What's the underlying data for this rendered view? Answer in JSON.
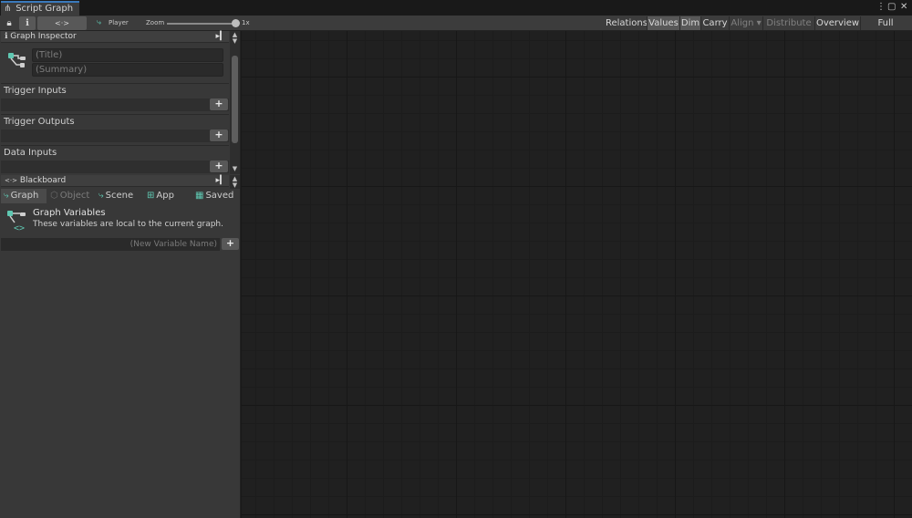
{
  "window": {
    "tab_title": "Script Graph",
    "tab_icon": "graph-icon",
    "menu_icon": "more-vertical-icon",
    "maximize_icon": "maximize-icon",
    "close_icon": "close-icon"
  },
  "toolbar": {
    "player_label": "Player",
    "zoom_label": "Zoom",
    "zoom_value": "1x",
    "right_buttons": [
      {
        "label": "Relations",
        "state": "normal"
      },
      {
        "label": "Values",
        "state": "active"
      },
      {
        "label": "Dim",
        "state": "active"
      },
      {
        "label": "Carry",
        "state": "normal"
      },
      {
        "label": "Align ▾",
        "state": "disabled"
      },
      {
        "label": "Distribute ▾",
        "state": "disabled"
      },
      {
        "label": "Overview",
        "state": "normal"
      },
      {
        "label": "Full Screen",
        "state": "normal"
      }
    ]
  },
  "graph_inspector": {
    "header": "Graph Inspector",
    "title_placeholder": "(Title)",
    "summary_placeholder": "(Summary)",
    "sections": [
      "Trigger Inputs",
      "Trigger Outputs",
      "Data Inputs"
    ],
    "add_label": "+"
  },
  "blackboard": {
    "header": "Blackboard",
    "tabs": [
      {
        "label": "Graph",
        "state": "active"
      },
      {
        "label": "Object",
        "state": "disabled"
      },
      {
        "label": "Scene",
        "state": "normal"
      },
      {
        "label": "App",
        "state": "normal"
      },
      {
        "label": "Saved",
        "state": "normal"
      }
    ],
    "variables_title": "Graph Variables",
    "variables_description": "These variables are local to the current graph.",
    "new_variable_placeholder": "(New Variable Name)",
    "add_label": "+"
  },
  "colors": {
    "accent_teal": "#5fc8b2",
    "tab_highlight": "#3a79bb"
  }
}
